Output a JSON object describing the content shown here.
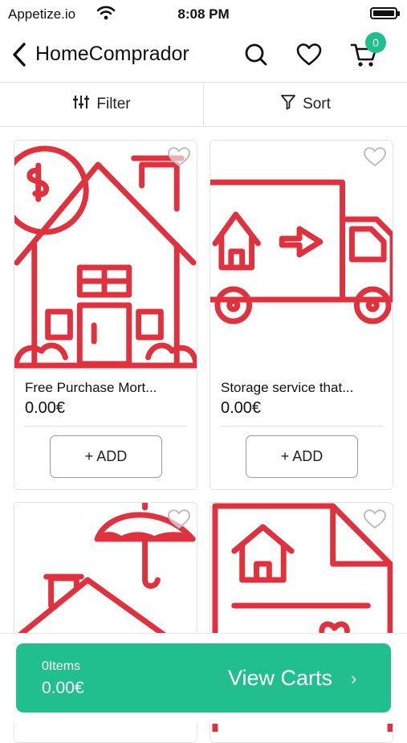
{
  "status": {
    "carrier": "Appetize.io",
    "time": "8:08 PM"
  },
  "nav": {
    "title": "HomeComprador",
    "cart_count": "0"
  },
  "filterbar": {
    "filter_label": "Filter",
    "sort_label": "Sort"
  },
  "products": [
    {
      "name": "Free Purchase Mort...",
      "price": "0.00€",
      "add_label": "+ ADD"
    },
    {
      "name": "Storage service that...",
      "price": "0.00€",
      "add_label": "+ ADD"
    },
    {
      "name": "",
      "price": "",
      "add_label": ""
    },
    {
      "name": "",
      "price": "",
      "add_label": ""
    }
  ],
  "cart": {
    "items_label": "0Items",
    "total": "0.00€",
    "view_label": "View Carts",
    "chevron": "›"
  },
  "colors": {
    "accent": "#21bf8e",
    "icon_red": "#e0313f"
  }
}
